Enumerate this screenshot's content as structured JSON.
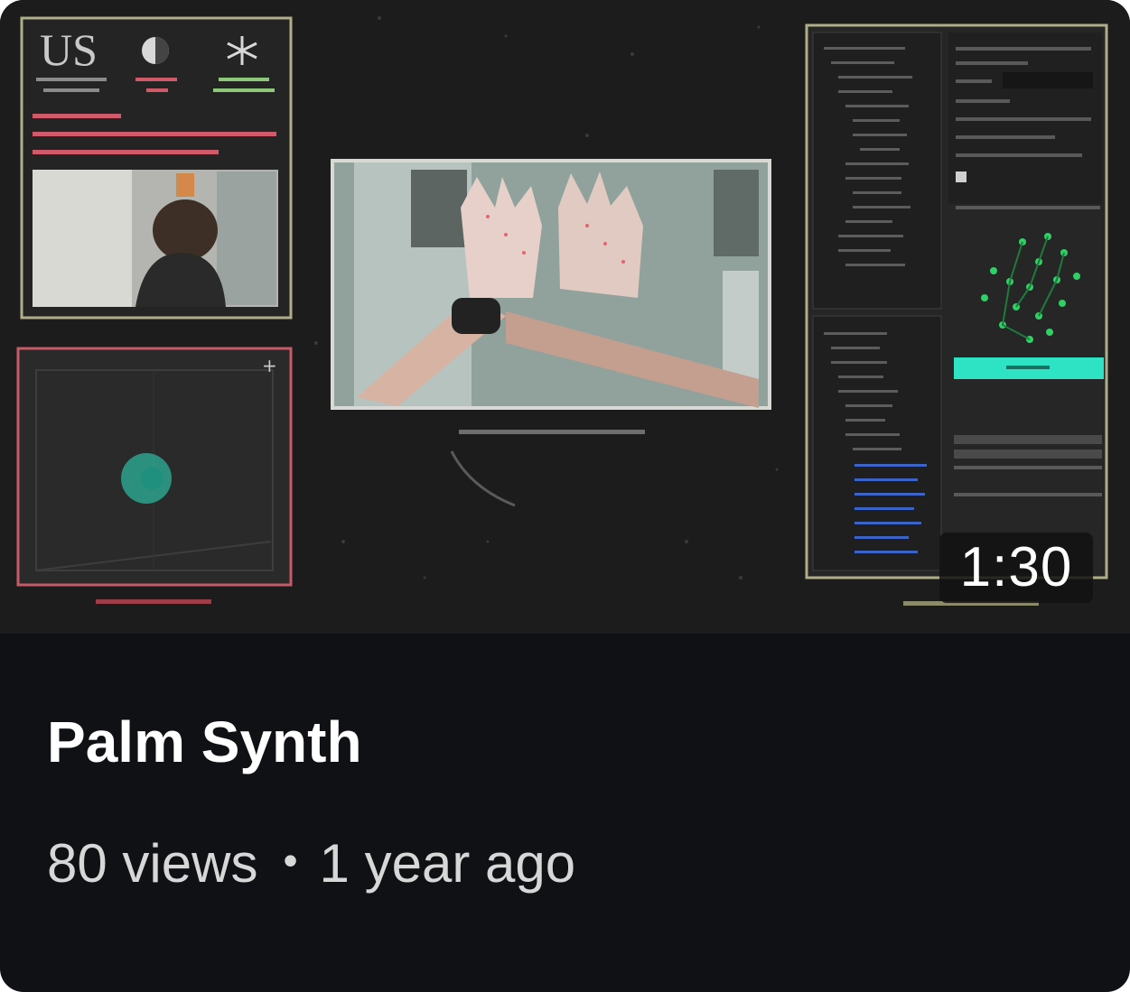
{
  "video": {
    "title": "Palm Synth",
    "views": "80 views",
    "separator": "•",
    "age": "1 year ago",
    "duration": "1:30"
  },
  "thumbnail": {
    "logo_text": "US",
    "colors": {
      "background": "#1b1b1b",
      "card": "#0f1114",
      "panel_border_olive": "#b0ae88",
      "panel_border_red": "#c75a68",
      "accent_cyan": "#2de3c4",
      "hand_point_green": "#2fd166"
    }
  }
}
